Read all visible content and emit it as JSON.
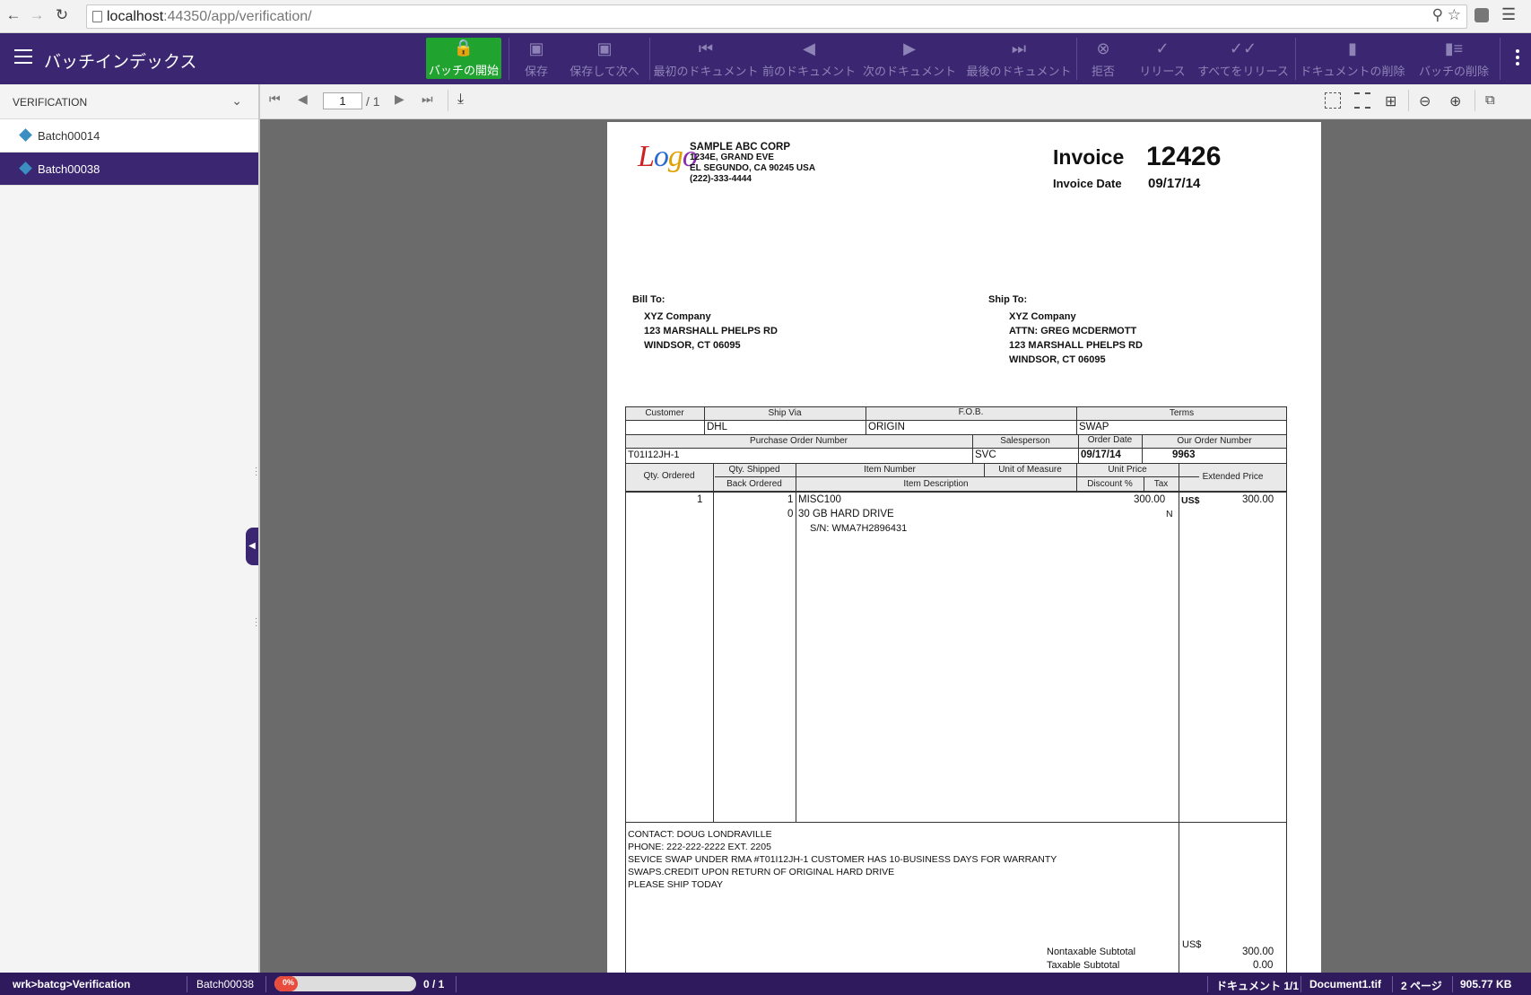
{
  "browser": {
    "back_icon": "arrow-left-icon",
    "url_host": "localhost",
    "url_rest": ":44350/app/verification/"
  },
  "toolbar": {
    "title": "バッチインデックス",
    "buttons": {
      "open_batch": "バッチの開始",
      "save": "保存",
      "save_next": "保存して次へ",
      "first_doc": "最初のドキュメント",
      "prev_doc": "前のドキュメント",
      "next_doc": "次のドキュメント",
      "last_doc": "最後のドキュメント",
      "reject": "拒否",
      "release": "リリース",
      "release_all": "すべてをリリース",
      "delete_doc": "ドキュメントの削除",
      "delete_batch": "バッチの削除"
    },
    "primary_color": "#21a330",
    "brand_color": "#3a2671"
  },
  "sidebar": {
    "header": "VERIFICATION",
    "items": [
      {
        "label": "Batch00014",
        "selected": false
      },
      {
        "label": "Batch00038",
        "selected": true
      }
    ]
  },
  "viewer": {
    "page_current": "1",
    "page_total": "/ 1"
  },
  "document": {
    "company": {
      "name": "SAMPLE ABC CORP",
      "line1": "1234E, GRAND EVE",
      "line2": "EL SEGUNDO, CA 90245 USA",
      "phone": "(222)-333-4444"
    },
    "invoice_label": "Invoice",
    "invoice_number": "12426",
    "invoice_date_label": "Invoice Date",
    "invoice_date": "09/17/14",
    "bill_to": {
      "label": "Bill To:",
      "name": "XYZ Company",
      "street": "123 MARSHALL PHELPS RD",
      "city": "WINDSOR, CT 06095"
    },
    "ship_to": {
      "label": "Ship To:",
      "name": "XYZ Company",
      "attn": "ATTN: GREG MCDERMOTT",
      "street": "123 MARSHALL PHELPS RD",
      "city": "WINDSOR, CT 06095"
    },
    "headers": {
      "customer": "Customer",
      "ship_via": "Ship Via",
      "fob": "F.O.B.",
      "terms": "Terms",
      "po_number": "Purchase Order Number",
      "salesperson": "Salesperson",
      "order_date": "Order Date",
      "our_order": "Our Order Number",
      "qty_ordered": "Qty. Ordered",
      "qty_shipped": "Qty. Shipped",
      "back_ordered": "Back Ordered",
      "item_number": "Item Number",
      "item_description": "Item Description",
      "uom": "Unit of Measure",
      "unit_price": "Unit Price",
      "discount": "Discount %",
      "tax": "Tax",
      "extended_price": "Extended Price"
    },
    "values": {
      "ship_via": "DHL",
      "fob": "ORIGIN",
      "terms": "SWAP",
      "po_number": "T01I12JH-1",
      "salesperson": "SVC",
      "order_date": "09/17/14",
      "our_order": "9963"
    },
    "line": {
      "qty_ordered": "1",
      "qty_shipped": "1",
      "back_ordered": "0",
      "item_number": "MISC100",
      "description": "30 GB HARD DRIVE",
      "serial": "S/N: WMA7H2896431",
      "unit_price": "300.00",
      "tax": "N",
      "currency": "US$",
      "extended": "300.00"
    },
    "notes": [
      "CONTACT: DOUG LONDRAVILLE",
      "PHONE:  222-222-2222 EXT. 2205",
      "SEVICE SWAP UNDER RMA #T01I12JH-1 CUSTOMER HAS 10-BUSINESS DAYS FOR WARRANTY",
      "SWAPS.CREDIT UPON RETURN OF ORIGINAL HARD DRIVE",
      "PLEASE SHIP TODAY"
    ],
    "totals": {
      "nontaxable_label": "Nontaxable Subtotal",
      "taxable_label": "Taxable Subtotal",
      "currency": "US$",
      "nontaxable": "300.00",
      "taxable": "0.00"
    }
  },
  "status": {
    "path": "wrk>batcg>Verification",
    "batch": "Batch00038",
    "progress_label": "0%",
    "progress_value": 0,
    "count": "0 / 1",
    "document": "ドキュメント 1/1",
    "filename": "Document1.tif",
    "pages": "2 ページ",
    "size": "905.77 KB"
  }
}
